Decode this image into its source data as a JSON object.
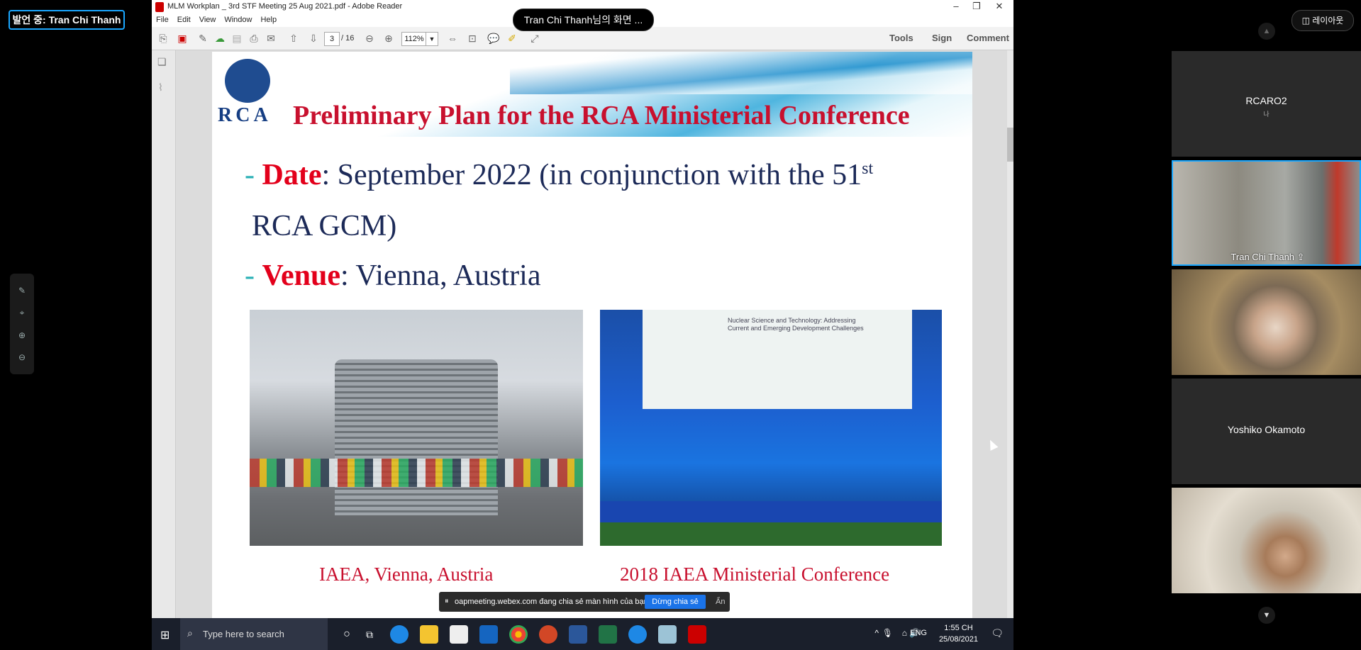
{
  "meeting": {
    "speaker_badge": "발언 중: Tran Chi Thanh",
    "share_banner": "Tran Chi Thanh님의 화면 ...",
    "layout_button": "레이아웃",
    "toast": {
      "message": "oapmeeting.webex.com đang chia sẻ màn hình của bạn.",
      "stop_button": "Dừng chia sẻ",
      "hide_button": "Ẩn"
    }
  },
  "reader": {
    "window_title": "MLM Workplan _ 3rd STF Meeting 25 Aug 2021.pdf - Adobe Reader",
    "menu": [
      "File",
      "Edit",
      "View",
      "Window",
      "Help"
    ],
    "page_current": "3",
    "page_total": "/ 16",
    "zoom": "112%",
    "right_tools": [
      "Tools",
      "Sign",
      "Comment"
    ]
  },
  "slide": {
    "logo_text": "RCA",
    "title": "Preliminary Plan for the RCA Ministerial Conference",
    "date_key": "Date",
    "date_text": ": September 2022 (in conjunction with the 51",
    "date_sup": "st",
    "date_cont": "RCA GCM)",
    "venue_key": "Venue",
    "venue_text": ": Vienna, Austria",
    "photo2_screen_text": "Nuclear Science and Technology: Addressing Current and Emerging Development Challenges",
    "caption1": "IAEA, Vienna, Austria",
    "caption2": "2018 IAEA Ministerial Conference"
  },
  "participants": [
    {
      "name": "RCARO2",
      "sub": "나"
    },
    {
      "name": "Tran Chi Thanh"
    },
    {
      "name": ""
    },
    {
      "name": "Yoshiko Okamoto"
    },
    {
      "name": ""
    }
  ],
  "taskbar": {
    "search_placeholder": "Type here to search",
    "lang": "ENG",
    "time": "1:55 CH",
    "date": "25/08/2021"
  }
}
